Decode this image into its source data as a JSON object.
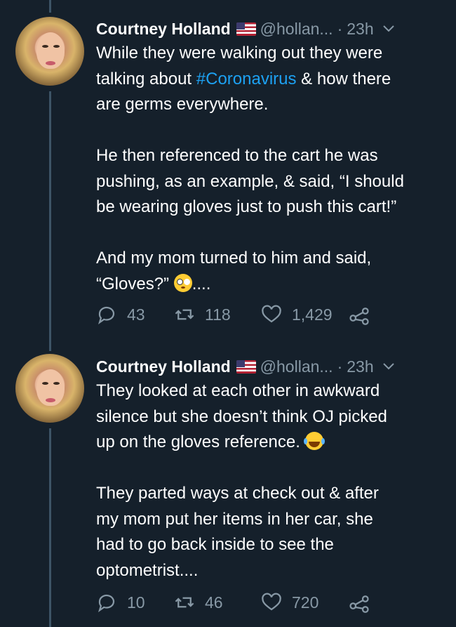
{
  "tweets": [
    {
      "name": "Courtney Holland",
      "handle": "@hollan...",
      "dot": "·",
      "time": "23h",
      "body": {
        "line1": "While they were walking out they were",
        "line2a": "talking about ",
        "hashtag": "#Coronavirus",
        "line2b": " & how there",
        "line3": "are germs everywhere.",
        "para2": "He then referenced to the cart he was\npushing, as an example, & said, “I should\nbe wearing gloves just to push this cart!”",
        "para3a": "And my mom turned to him and said,\n“Gloves?” ",
        "para3b": "...."
      },
      "actions": {
        "replies": "43",
        "retweets": "118",
        "likes": "1,429"
      }
    },
    {
      "name": "Courtney Holland",
      "handle": "@hollan...",
      "dot": "·",
      "time": "23h",
      "body": {
        "para1": "They looked at each other in awkward\nsilence but she doesn’t think OJ picked\nup on the gloves reference. ",
        "para2": "They parted ways at check out & after\nmy mom put her items in her car, she\nhad to go back inside to see the\noptometrist...."
      },
      "actions": {
        "replies": "10",
        "retweets": "46",
        "likes": "720"
      }
    }
  ],
  "icons": {
    "reply": "reply-icon",
    "retweet": "retweet-icon",
    "like": "like-icon",
    "share": "share-icon",
    "caret": "chevron-down-icon"
  },
  "colors": {
    "background": "#15202b",
    "text": "#ffffff",
    "muted": "#8899a6",
    "link": "#1da1f2",
    "thread_line": "#3d5466"
  }
}
